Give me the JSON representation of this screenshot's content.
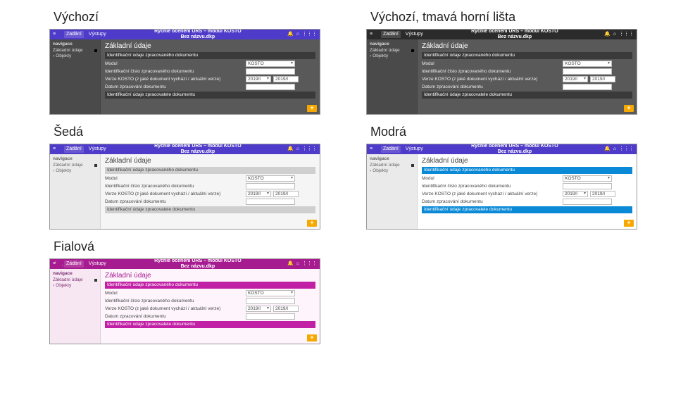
{
  "captions": {
    "default": "Výchozí",
    "default_darktop": "Výchozí, tmavá horní lišta",
    "gray": "Šedá",
    "blue": "Modrá",
    "magenta": "Fialová"
  },
  "topbar": {
    "hamburger": "≡",
    "tab_zadani": "Zadání",
    "tab_vystupy": "Výstupy",
    "title_line1": "Rychlé ocenění ÚRS – modul KOSTO",
    "title_line2": "Bez názvu.dkp",
    "icon_bell": "🔔",
    "icon_home": "⌂",
    "icon_grid": "⋮⋮⋮"
  },
  "sidebar": {
    "title": "navigace",
    "item1": "Základní údaje",
    "item2": "Objekty"
  },
  "form": {
    "page_title": "Základní údaje",
    "section1": "Identifikační údaje zpracovaného dokumentu",
    "row_modul_label": "Modul",
    "row_modul_value": "KOSTO",
    "row_ident_label": "Identifikační číslo zpracovaného dokumentu",
    "row_verze_label": "Verze KOSTO (z jaké dokument vychází / aktuální verze)",
    "row_verze_value1": "2019/I",
    "row_verze_value2": "2019/I",
    "row_datum_label": "Datum zpracování dokumentu",
    "section2": "Identifikační údaje zpracovatele dokumentu",
    "fab": "+"
  }
}
